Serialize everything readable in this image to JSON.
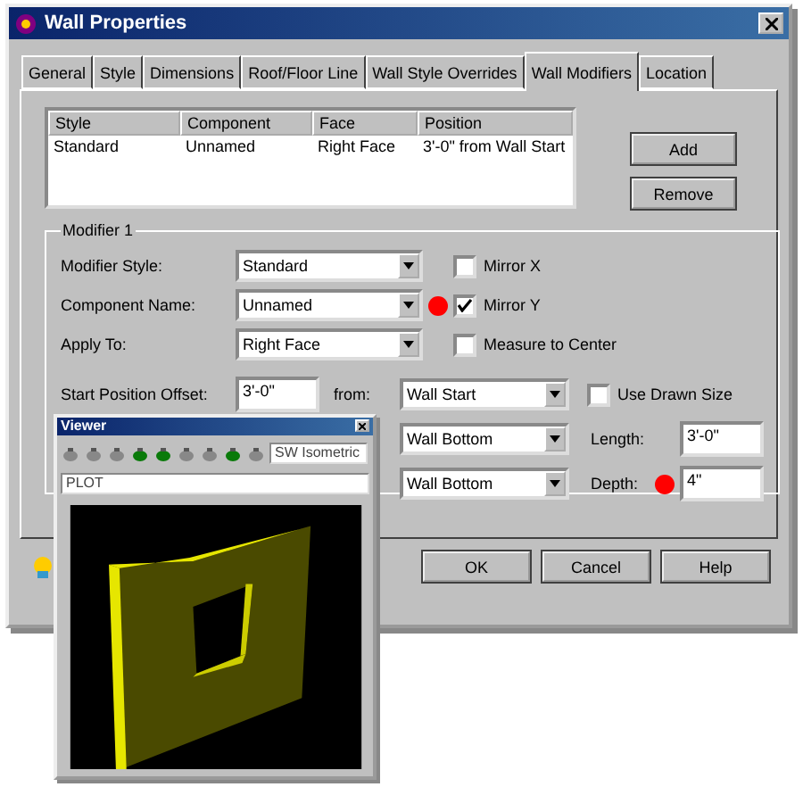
{
  "window": {
    "title": "Wall Properties"
  },
  "tabs": [
    {
      "label": "General",
      "selected": false
    },
    {
      "label": "Style",
      "selected": false
    },
    {
      "label": "Dimensions",
      "selected": false
    },
    {
      "label": "Roof/Floor Line",
      "selected": false
    },
    {
      "label": "Wall Style Overrides",
      "selected": false
    },
    {
      "label": "Wall Modifiers",
      "selected": true
    },
    {
      "label": "Location",
      "selected": false
    }
  ],
  "modifier_list": {
    "columns": [
      "Style",
      "Component",
      "Face",
      "Position"
    ],
    "rows": [
      [
        "Standard",
        "Unnamed",
        "Right Face",
        "3'-0\" from Wall Start"
      ]
    ]
  },
  "list_buttons": [
    "Add",
    "Remove"
  ],
  "group": {
    "title": "Modifier 1",
    "combo_rows": [
      {
        "label": "Modifier Style:",
        "value": "Standard",
        "flagged": false,
        "option": {
          "label": "Mirror X",
          "checked": false
        }
      },
      {
        "label": "Component Name:",
        "value": "Unnamed",
        "flagged": true,
        "option": {
          "label": "Mirror Y",
          "checked": true
        }
      },
      {
        "label": "Apply To:",
        "value": "Right Face",
        "flagged": false,
        "option": {
          "label": "Measure to Center",
          "checked": false
        }
      }
    ],
    "start_position": {
      "label": "Start Position Offset:",
      "value": "3'-0\"",
      "from_label": "from:",
      "from_value": "Wall Start",
      "option": {
        "label": "Use Drawn Size",
        "checked": false
      }
    },
    "elevation_row": {
      "from_value": "Wall Bottom",
      "label": "Length:",
      "value": "3'-0\"",
      "flagged": false
    },
    "depth_row": {
      "from_value": "Wall Bottom",
      "label": "Depth:",
      "value": "4\"",
      "flagged": true
    }
  },
  "footer_buttons": [
    "OK",
    "Cancel",
    "Help"
  ],
  "viewer": {
    "title": "Viewer",
    "view": "SW Isometric",
    "layer": "PLOT"
  }
}
